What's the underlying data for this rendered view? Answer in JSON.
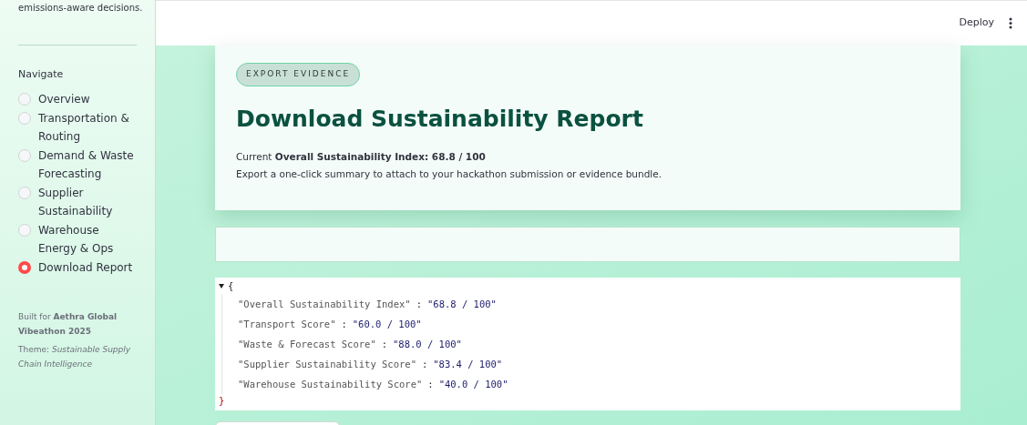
{
  "sidebar": {
    "intro_tail": "emissions-aware decisions.",
    "nav_label": "Navigate",
    "items": [
      {
        "label": "Overview",
        "selected": false
      },
      {
        "label": "Transportation & Routing",
        "selected": false
      },
      {
        "label": "Demand & Waste Forecasting",
        "selected": false
      },
      {
        "label": "Supplier Sustainability",
        "selected": false
      },
      {
        "label": "Warehouse Energy & Ops",
        "selected": false
      },
      {
        "label": "Download Report",
        "selected": true
      }
    ],
    "footer": [
      "Built for **Aethra Global Vibeathon 2025**",
      "Theme: *Sustainable Supply Chain Intelligence*"
    ]
  },
  "header": {
    "deploy": "Deploy"
  },
  "card": {
    "badge": "EXPORT EVIDENCE",
    "title": "Download Sustainability Report",
    "lines": [
      "Current **Overall Sustainability Index: 68.8 / 100**",
      "Export a one-click summary to attach to your hackathon submission or evidence bundle."
    ]
  },
  "json_view": {
    "open": "{",
    "close": "}",
    "entries": [
      {
        "key": "\"Overall Sustainability Index\"",
        "sep": ":",
        "value": "\"68.8 / 100\""
      },
      {
        "key": "\"Transport Score\"",
        "sep": ":",
        "value": "\"60.0 / 100\""
      },
      {
        "key": "\"Waste & Forecast Score\"",
        "sep": ":",
        "value": "\"88.0 / 100\""
      },
      {
        "key": "\"Supplier Sustainability Score\"",
        "sep": ":",
        "value": "\"83.4 / 100\""
      },
      {
        "key": "\"Warehouse Sustainability Score\"",
        "sep": ":",
        "value": "\"40.0 / 100\""
      }
    ]
  }
}
